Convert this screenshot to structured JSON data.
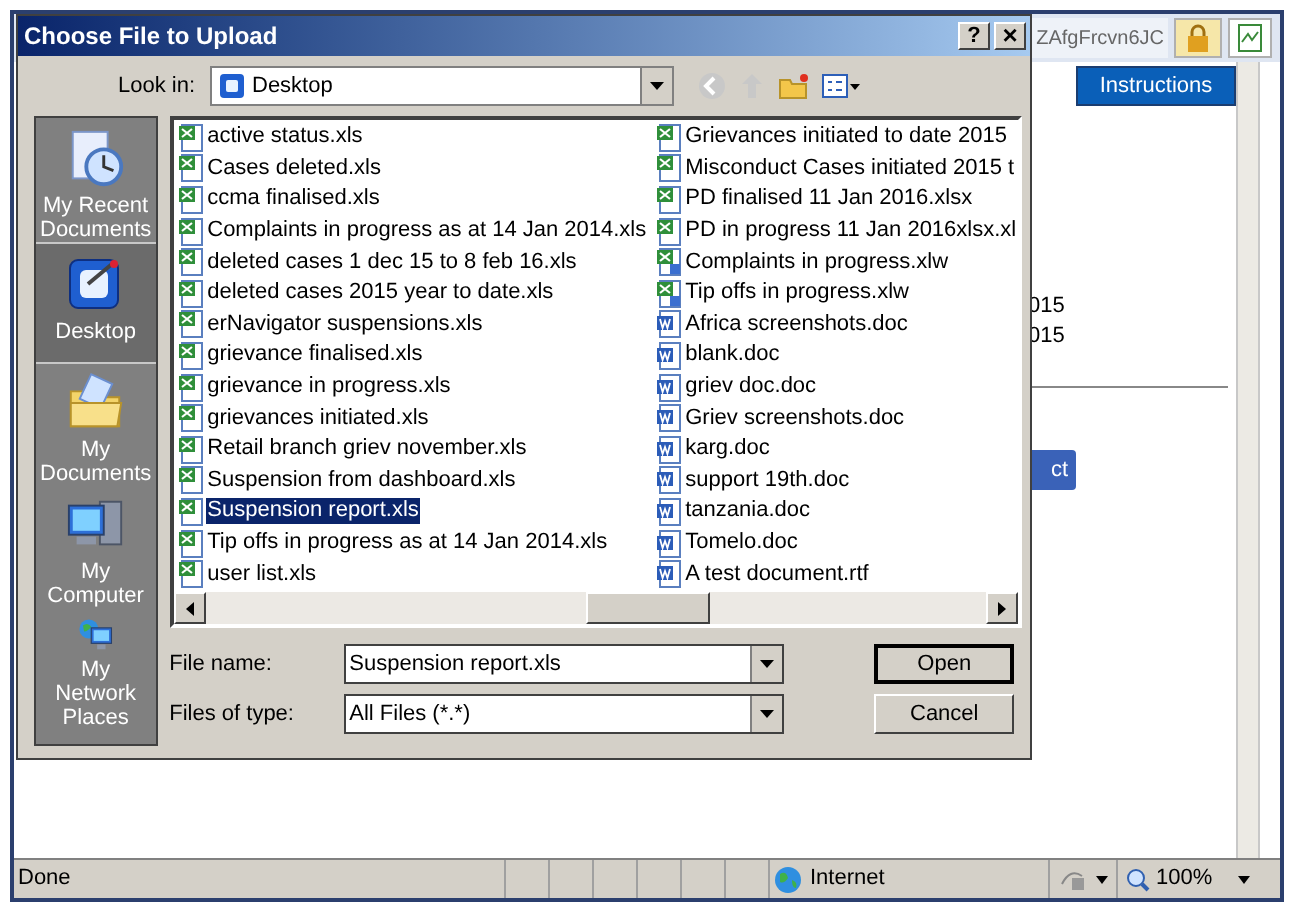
{
  "browser": {
    "address_fragment": "ZAfgFrcvn6JC",
    "instructions_button": "Instructions",
    "page_fragments": [
      "015",
      "015"
    ],
    "button_fragment": "ct",
    "status_bar": {
      "text": "Done",
      "zone": "Internet",
      "zoom": "100%"
    }
  },
  "dialog": {
    "title": "Choose File to Upload",
    "help_button": "?",
    "close_button": "×",
    "look_in": {
      "label": "Look in:",
      "value": "Desktop"
    },
    "places": [
      {
        "label": "My Recent Documents",
        "kind": "recent",
        "selected": false
      },
      {
        "label": "Desktop",
        "kind": "desktop",
        "selected": true
      },
      {
        "label": "My Documents",
        "kind": "documents",
        "selected": false
      },
      {
        "label": "My Computer",
        "kind": "computer",
        "selected": false
      },
      {
        "label": "My Network Places",
        "kind": "network",
        "selected": false
      }
    ],
    "file_columns": [
      [
        {
          "name": "active status.xls",
          "kind": "xls",
          "selected": false
        },
        {
          "name": "Cases deleted.xls",
          "kind": "xls",
          "selected": false
        },
        {
          "name": "ccma finalised.xls",
          "kind": "xls",
          "selected": false
        },
        {
          "name": "Complaints in progress as at 14 Jan 2014.xls",
          "kind": "xls",
          "selected": false
        },
        {
          "name": "deleted cases 1 dec 15 to 8 feb 16.xls",
          "kind": "xls",
          "selected": false
        },
        {
          "name": "deleted cases 2015 year to date.xls",
          "kind": "xls",
          "selected": false
        },
        {
          "name": "erNavigator suspensions.xls",
          "kind": "xls",
          "selected": false
        },
        {
          "name": "grievance finalised.xls",
          "kind": "xls",
          "selected": false
        },
        {
          "name": "grievance in progress.xls",
          "kind": "xls",
          "selected": false
        },
        {
          "name": "grievances initiated.xls",
          "kind": "xls",
          "selected": false
        },
        {
          "name": "Retail branch griev november.xls",
          "kind": "xls",
          "selected": false
        },
        {
          "name": "Suspension from dashboard.xls",
          "kind": "xls",
          "selected": false
        },
        {
          "name": "Suspension report.xls",
          "kind": "xls",
          "selected": true
        },
        {
          "name": "Tip offs in progress as at 14 Jan 2014.xls",
          "kind": "xls",
          "selected": false
        },
        {
          "name": "user list.xls",
          "kind": "xls",
          "selected": false
        }
      ],
      [
        {
          "name": "Grievances initiated to date 2015",
          "kind": "xls",
          "selected": false
        },
        {
          "name": "Misconduct Cases initiated 2015 t",
          "kind": "xls",
          "selected": false
        },
        {
          "name": "PD finalised 11 Jan 2016.xlsx",
          "kind": "xls",
          "selected": false
        },
        {
          "name": "PD in progress 11 Jan 2016xlsx.xl",
          "kind": "xls",
          "selected": false
        },
        {
          "name": "Complaints in progress.xlw",
          "kind": "xlw",
          "selected": false
        },
        {
          "name": "Tip offs in progress.xlw",
          "kind": "xlw",
          "selected": false
        },
        {
          "name": "Africa screenshots.doc",
          "kind": "doc",
          "selected": false
        },
        {
          "name": "blank.doc",
          "kind": "doc",
          "selected": false
        },
        {
          "name": "griev doc.doc",
          "kind": "doc",
          "selected": false
        },
        {
          "name": "Griev screenshots.doc",
          "kind": "doc",
          "selected": false
        },
        {
          "name": "karg.doc",
          "kind": "doc",
          "selected": false
        },
        {
          "name": "support 19th.doc",
          "kind": "doc",
          "selected": false
        },
        {
          "name": "tanzania.doc",
          "kind": "doc",
          "selected": false
        },
        {
          "name": "Tomelo.doc",
          "kind": "doc",
          "selected": false
        },
        {
          "name": "A test document.rtf",
          "kind": "doc",
          "selected": false
        }
      ]
    ],
    "file_name": {
      "label": "File name:",
      "value": "Suspension report.xls"
    },
    "file_type": {
      "label": "Files of type:",
      "value": "All Files (*.*)"
    },
    "buttons": [
      {
        "label": "Open",
        "kind": "default"
      },
      {
        "label": "Cancel",
        "kind": "normal"
      }
    ]
  }
}
